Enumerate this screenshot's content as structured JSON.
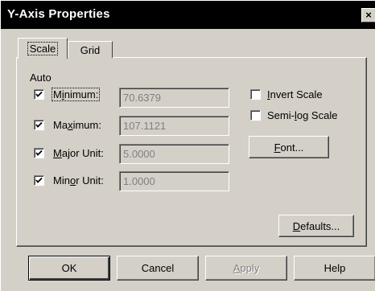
{
  "window": {
    "title": "Y-Axis Properties",
    "close_glyph": "×"
  },
  "tabs": [
    {
      "label": "Scale",
      "active": true
    },
    {
      "label": "Grid",
      "active": false
    }
  ],
  "auto_label": "Auto",
  "rows": [
    {
      "label_pre": "M",
      "label_ul": "i",
      "label_post": "nimum:",
      "checked": true,
      "value": "70.6379"
    },
    {
      "label_pre": "Ma",
      "label_ul": "x",
      "label_post": "imum:",
      "checked": true,
      "value": "107.1121"
    },
    {
      "label_pre": "",
      "label_ul": "M",
      "label_post": "ajor Unit:",
      "checked": true,
      "value": "5.0000"
    },
    {
      "label_pre": "Min",
      "label_ul": "o",
      "label_post": "r Unit:",
      "checked": true,
      "value": "1.0000"
    }
  ],
  "options": [
    {
      "label_pre": "",
      "label_ul": "I",
      "label_post": "nvert Scale",
      "checked": false
    },
    {
      "label_pre": "Semi-",
      "label_ul": "l",
      "label_post": "og Scale",
      "checked": false
    }
  ],
  "font_button": {
    "label_ul": "F",
    "label_post": "ont..."
  },
  "defaults_button": {
    "label_ul": "D",
    "label_post": "efaults..."
  },
  "footer": {
    "ok": "OK",
    "cancel": "Cancel",
    "apply_ul": "A",
    "apply_post": "pply",
    "help": "Help"
  }
}
